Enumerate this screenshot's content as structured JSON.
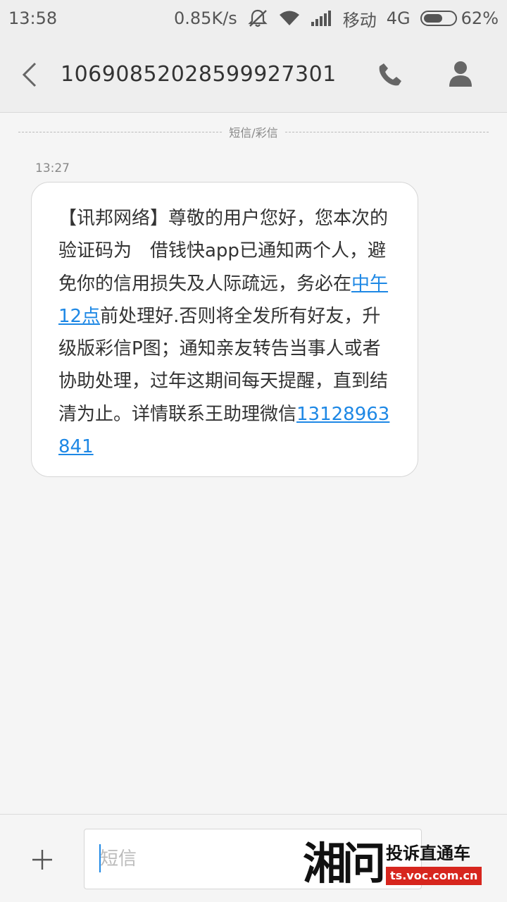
{
  "status_bar": {
    "time": "13:58",
    "speed": "0.85K/s",
    "carrier": "移动",
    "network": "4G",
    "battery_percent": "62%",
    "battery_level": 0.62,
    "icons": [
      "mute-vibrate-icon",
      "wifi-icon",
      "signal-icon",
      "battery-icon"
    ]
  },
  "header": {
    "title": "10690852028599927301",
    "icons": [
      "back-icon",
      "phone-icon",
      "contact-icon"
    ]
  },
  "divider_label": "短信/彩信",
  "message": {
    "time": "13:27",
    "parts": [
      {
        "text": "【讯邦网络】尊敬的用户您好，您本次的验证码为　借钱快app已通知两个人，避免你的信用损失及人际疏远，务必在",
        "link": false
      },
      {
        "text": "中午12点",
        "link": true
      },
      {
        "text": "前处理好.否则将全发所有好友，升级版彩信P图；通知亲友转告当事人或者协助处理，过年这期间每天提醒，直到结清为止。详情联系王助理微信",
        "link": false
      },
      {
        "text": "13128963841",
        "link": true
      }
    ]
  },
  "composer": {
    "placeholder": "短信",
    "icons": [
      "plus-icon"
    ]
  },
  "watermark": {
    "logo": "湘问",
    "title": "投诉直通车",
    "url": "ts.voc.com.cn"
  },
  "colors": {
    "link": "#1e88e5",
    "watermark_red": "#d7261e"
  }
}
